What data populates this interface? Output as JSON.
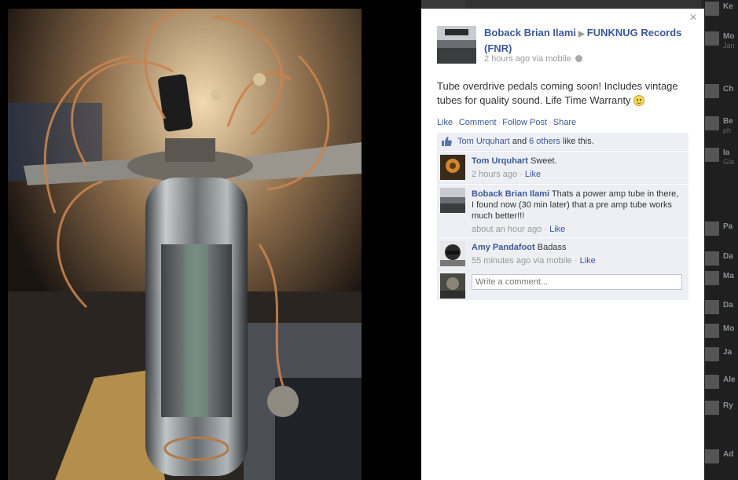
{
  "post": {
    "author": "Boback Brian Ilami",
    "target": "FUNKNUG Records (FNR)",
    "meta": "2 hours ago via mobile",
    "text": "Tube overdrive pedals coming soon! Includes vintage tubes for quality sound. Life Time Warranty"
  },
  "actions": {
    "like": "Like",
    "comment": "Comment",
    "follow": "Follow Post",
    "share": "Share"
  },
  "likes": {
    "name": "Tom Urquhart",
    "and": "and",
    "others": "6 others",
    "suffix": "like this."
  },
  "comments": [
    {
      "name": "Tom Urquhart",
      "text": "Sweet.",
      "time": "2 hours ago",
      "like": "Like"
    },
    {
      "name": "Boback Brian Ilami",
      "text": "Thats a power amp tube in there, I found now (30 min later) that a pre amp tube works much better!!!",
      "time": "about an hour ago",
      "like": "Like"
    },
    {
      "name": "Amy Pandafoot",
      "text": "Badass",
      "time": "55 minutes ago via mobile",
      "like": "Like"
    }
  ],
  "composer": {
    "placeholder": "Write a comment..."
  },
  "ticker": [
    {
      "name": "Ke",
      "sub": ""
    },
    {
      "name": "Mo",
      "sub": "Jan"
    },
    {
      "name": "Ch",
      "sub": ""
    },
    {
      "name": "Be",
      "sub": "ph"
    },
    {
      "name": "Ia",
      "sub": "Gla"
    },
    {
      "name": "Pa",
      "sub": ""
    },
    {
      "name": "Da",
      "sub": ""
    },
    {
      "name": "Ma",
      "sub": ""
    },
    {
      "name": "Da",
      "sub": ""
    },
    {
      "name": "Mo",
      "sub": ""
    },
    {
      "name": "Ja",
      "sub": ""
    },
    {
      "name": "Ale",
      "sub": ""
    },
    {
      "name": "Ry",
      "sub": ""
    },
    {
      "name": "Ad",
      "sub": ""
    }
  ],
  "colors": {
    "link": "#3b5998",
    "ufi_bg": "#edeff4",
    "meta": "#999999"
  }
}
